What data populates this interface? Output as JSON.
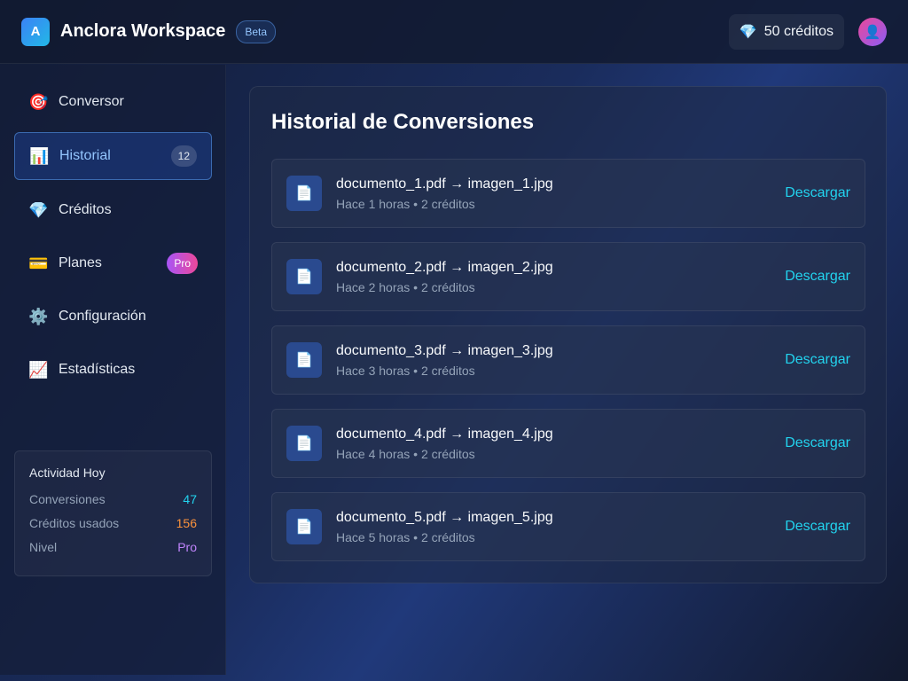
{
  "header": {
    "logo_letter": "A",
    "title": "Anclora Workspace",
    "badge": "Beta",
    "credits_icon": "gem-icon",
    "credits_label": "50 créditos",
    "avatar_icon": "user-avatar-icon"
  },
  "sidebar": {
    "items": [
      {
        "label": "Conversor",
        "icon": "target-icon"
      },
      {
        "label": "Historial",
        "icon": "bar-chart-icon",
        "badge": "12",
        "active": true
      },
      {
        "label": "Créditos",
        "icon": "gem-icon"
      },
      {
        "label": "Planes",
        "icon": "credit-card-icon",
        "badge": "Pro"
      },
      {
        "label": "Configuración",
        "icon": "gear-icon"
      },
      {
        "label": "Estadísticas",
        "icon": "trending-up-icon"
      }
    ],
    "activity": {
      "title": "Actividad Hoy",
      "stats": [
        {
          "label": "Conversiones",
          "value": "47"
        },
        {
          "label": "Créditos usados",
          "value": "156"
        },
        {
          "label": "Nivel",
          "value": "Pro"
        }
      ]
    }
  },
  "main": {
    "title": "Historial de Conversiones",
    "download_label": "Descargar",
    "file_icon": "document-icon",
    "conversions": [
      {
        "name": "documento_1.pdf → imagen_1.jpg",
        "meta": "Hace 1 horas • 2 créditos"
      },
      {
        "name": "documento_2.pdf → imagen_2.jpg",
        "meta": "Hace 2 horas • 2 créditos"
      },
      {
        "name": "documento_3.pdf → imagen_3.jpg",
        "meta": "Hace 3 horas • 2 créditos"
      },
      {
        "name": "documento_4.pdf → imagen_4.jpg",
        "meta": "Hace 4 horas • 2 créditos"
      },
      {
        "name": "documento_5.pdf → imagen_5.jpg",
        "meta": "Hace 5 horas • 2 créditos"
      }
    ]
  },
  "colors": {
    "accent": "#22d3ee",
    "active_nav": "#93c5fd",
    "credits_used": "#fb923c",
    "level": "#c084fc"
  }
}
